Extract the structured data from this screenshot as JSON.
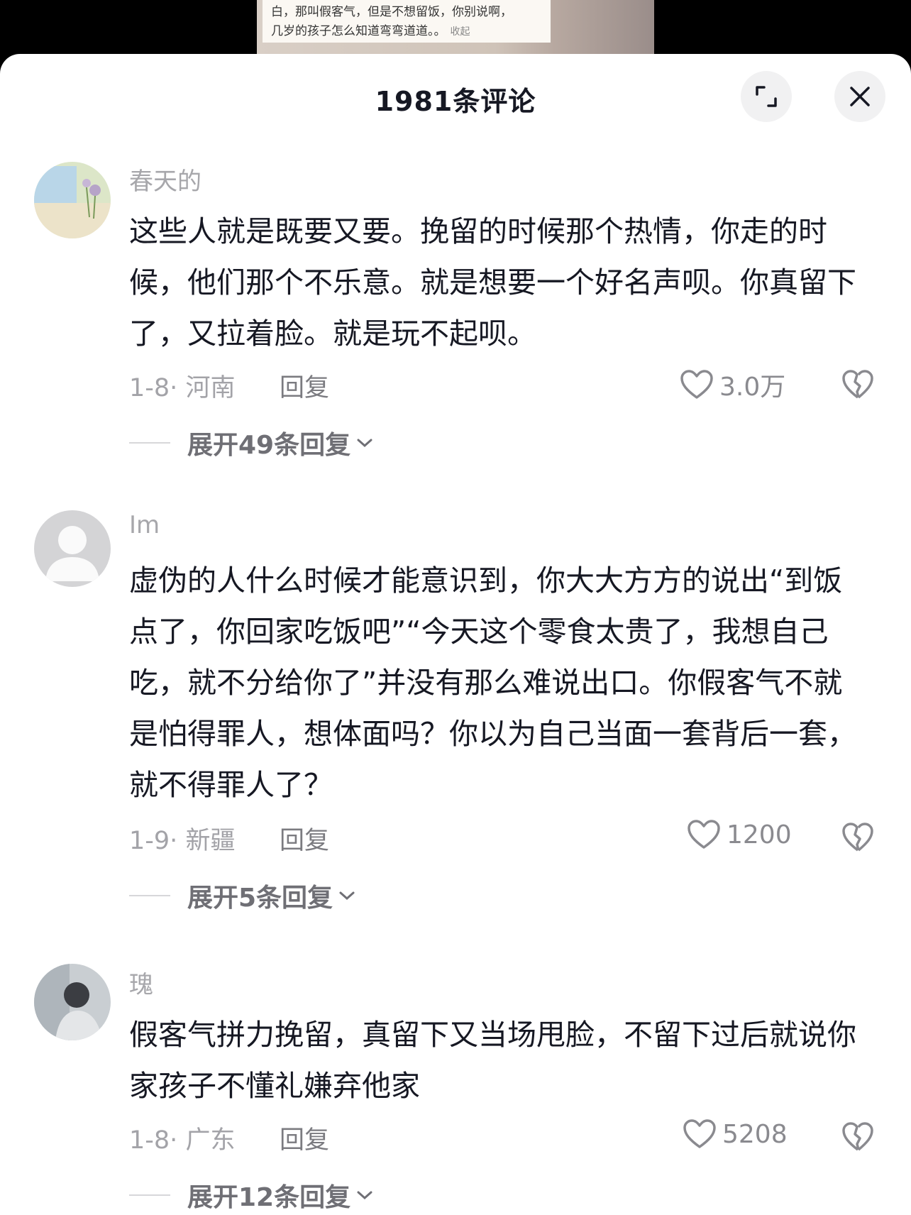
{
  "video": {
    "caption_line1": "白，那叫假客气，但是不想留饭，你别说啊，",
    "caption_line2": "几岁的孩子怎么知道弯弯道道。。",
    "collapse_label": "收起"
  },
  "header": {
    "title": "1981条评论",
    "expand_icon": "expand-icon",
    "close_icon": "close-icon"
  },
  "comments": [
    {
      "username": "春天的",
      "text": "这些人就是既要又要。挽留的时候那个热情，你走的时候，他们那个不乐意。就是想要一个好名声呗。你真留下了，又拉着脸。就是玩不起呗。",
      "date": "1-8",
      "location": "河南",
      "reply_label": "回复",
      "likes": "3.0万",
      "expand_replies": "展开49条回复"
    },
    {
      "username": "Im",
      "text": "虚伪的人什么时候才能意识到，你大大方方的说出“到饭点了，你回家吃饭吧”“今天这个零食太贵了，我想自己吃，就不分给你了”并没有那么难说出口。你假客气不就是怕得罪人，想体面吗？你以为自己当面一套背后一套，就不得罪人了？",
      "date": "1-9",
      "location": "新疆",
      "reply_label": "回复",
      "likes": "1200",
      "expand_replies": "展开5条回复"
    },
    {
      "username": "瑰",
      "text": "假客气拼力挽留，真留下又当场甩脸，不留下过后就说你家孩子不懂礼嫌弃他家",
      "date": "1-8",
      "location": "广东",
      "reply_label": "回复",
      "likes": "5208",
      "expand_replies": "展开12条回复"
    }
  ],
  "colors": {
    "text_primary": "#161823",
    "text_secondary": "#a3a3a8",
    "sheet_bg": "#ffffff"
  }
}
